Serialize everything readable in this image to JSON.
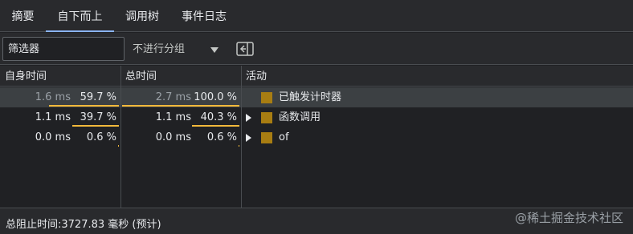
{
  "tabs": [
    {
      "label": "摘要"
    },
    {
      "label": "自下而上"
    },
    {
      "label": "调用树"
    },
    {
      "label": "事件日志"
    }
  ],
  "toolbar": {
    "filter_placeholder": "筛选器",
    "group_value": "不进行分组"
  },
  "columns": {
    "self_time": "自身时间",
    "total_time": "总时间",
    "activity": "活动"
  },
  "rows": [
    {
      "self_ms": "1.6 ms",
      "self_pct": "59.7 %",
      "self_fraction": 0.597,
      "total_ms": "2.7 ms",
      "total_pct": "100.0 %",
      "total_fraction": 1.0,
      "activity": "已触发计时器",
      "expandable": false,
      "color": "#a87d12"
    },
    {
      "self_ms": "1.1 ms",
      "self_pct": "39.7 %",
      "self_fraction": 0.397,
      "total_ms": "1.1 ms",
      "total_pct": "40.3 %",
      "total_fraction": 0.403,
      "activity": "函数调用",
      "expandable": true,
      "color": "#a87d12"
    },
    {
      "self_ms": "0.0 ms",
      "self_pct": "0.6 %",
      "self_fraction": 0.006,
      "total_ms": "0.0 ms",
      "total_pct": "0.6 %",
      "total_fraction": 0.006,
      "activity": "of",
      "expandable": true,
      "color": "#a87d12"
    }
  ],
  "status": {
    "text": "总阻止时间:3727.83 毫秒 (预计)"
  },
  "watermark": "@稀土掘金技术社区",
  "colors": {
    "bar": "#f2b93b",
    "accent": "#8ab4f8",
    "selected_row": "#3c4043"
  }
}
